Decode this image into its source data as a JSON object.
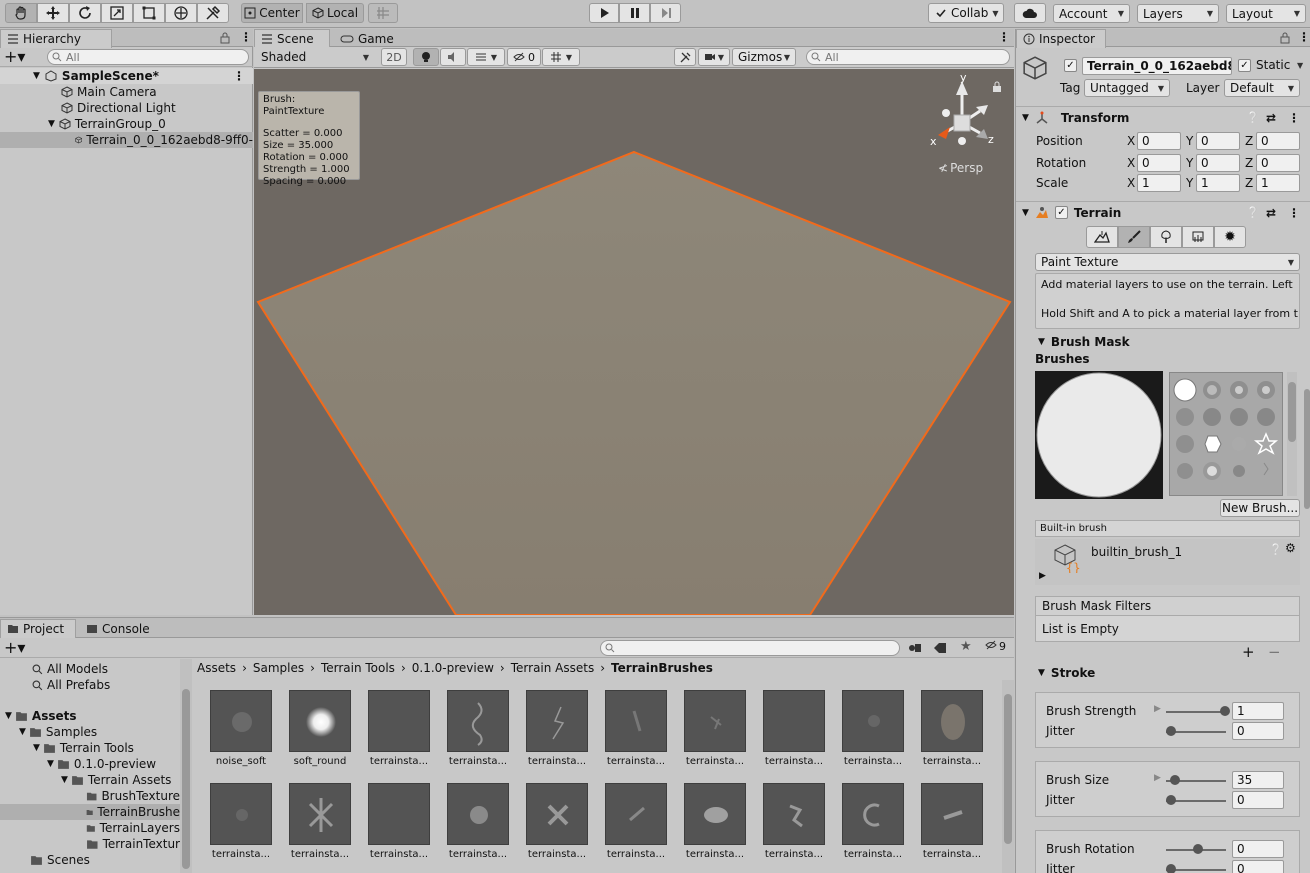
{
  "toolbar": {
    "tools": [
      "hand-icon",
      "move-icon",
      "rotate-icon",
      "scale-icon",
      "rect-icon",
      "transform-icon",
      "custom-tool-icon"
    ],
    "pivot_mode": "Center",
    "pivot_space": "Local",
    "collab_label": "Collab",
    "account_label": "Account",
    "layers_label": "Layers",
    "layout_label": "Layout"
  },
  "hierarchy": {
    "tab_label": "Hierarchy",
    "search_placeholder": "All",
    "scene_name": "SampleScene*",
    "items": [
      {
        "label": "Main Camera"
      },
      {
        "label": "Directional Light"
      },
      {
        "label": "TerrainGroup_0"
      },
      {
        "label": "Terrain_0_0_162aebd8-9ff0-"
      }
    ]
  },
  "scene_view": {
    "tabs": [
      {
        "label": "Scene"
      },
      {
        "label": "Game"
      }
    ],
    "shading_mode": "Shaded",
    "mode_2d": "2D",
    "hidden_count": "0",
    "gizmos_label": "Gizmos",
    "search_placeholder": "All",
    "persp_label": "Persp",
    "gizmo_axes": {
      "y": "y",
      "x": "x",
      "z": "z"
    },
    "brush_overlay": {
      "title": "Brush: PaintTexture",
      "lines": [
        "Scatter = 0.000",
        "Size = 35.000",
        "Rotation = 0.000",
        "Strength = 1.000",
        "Spacing = 0.000"
      ]
    },
    "terrain_color": "#8b8375",
    "outline_color": "#f26a1b"
  },
  "project": {
    "tabs": [
      {
        "label": "Project"
      },
      {
        "label": "Console"
      }
    ],
    "hidden_count": "9",
    "favorites": [
      {
        "label": "All Models"
      },
      {
        "label": "All Prefabs"
      }
    ],
    "tree": [
      {
        "label": "Assets"
      },
      {
        "label": "Samples"
      },
      {
        "label": "Terrain Tools"
      },
      {
        "label": "0.1.0-preview"
      },
      {
        "label": "Terrain Assets"
      },
      {
        "label": "BrushTexture"
      },
      {
        "label": "TerrainBrushe"
      },
      {
        "label": "TerrainLayers"
      },
      {
        "label": "TerrainTextur"
      },
      {
        "label": "Scenes"
      }
    ],
    "breadcrumb": [
      "Assets",
      "Samples",
      "Terrain Tools",
      "0.1.0-preview",
      "Terrain Assets",
      "TerrainBrushes"
    ],
    "assets_row1": [
      "noise_soft",
      "soft_round",
      "terrainsta...",
      "terrainsta...",
      "terrainsta...",
      "terrainsta...",
      "terrainsta...",
      "terrainsta...",
      "terrainsta...",
      "terrainsta..."
    ],
    "assets_row2": [
      "terrainsta...",
      "terrainsta...",
      "terrainsta...",
      "terrainsta...",
      "terrainsta...",
      "terrainsta...",
      "terrainsta...",
      "terrainsta...",
      "terrainsta...",
      "terrainsta..."
    ]
  },
  "inspector": {
    "tab_label": "Inspector",
    "object_name": "Terrain_0_0_162aebd8-9",
    "static_label": "Static",
    "tag_label": "Tag",
    "tag_value": "Untagged",
    "layer_label": "Layer",
    "layer_value": "Default",
    "transform": {
      "title": "Transform",
      "rows": [
        {
          "label": "Position",
          "x": "0",
          "y": "0",
          "z": "0"
        },
        {
          "label": "Rotation",
          "x": "0",
          "y": "0",
          "z": "0"
        },
        {
          "label": "Scale",
          "x": "1",
          "y": "1",
          "z": "1"
        }
      ],
      "axis_x": "X",
      "axis_y": "Y",
      "axis_z": "Z"
    },
    "terrain": {
      "title": "Terrain",
      "tool_icons": [
        "raise-terrain-icon",
        "paint-brush-icon",
        "tree-icon",
        "detail-icon",
        "settings-icon"
      ],
      "tool_select": "Paint Texture",
      "help_line1": "Add material layers to use on the terrain. Left",
      "help_line2": "Hold Shift and A to pick a material layer from t"
    },
    "brush_mask": {
      "title": "Brush Mask",
      "brushes_label": "Brushes",
      "new_brush_label": "New Brush...",
      "built_in_label": "Built-in brush",
      "brush_name": "builtin_brush_1",
      "filters_title": "Brush Mask Filters",
      "filters_empty": "List is Empty"
    },
    "stroke": {
      "title": "Stroke",
      "groups": [
        {
          "label": "Brush Strength",
          "value": "1",
          "jitter_label": "Jitter",
          "jitter": "0",
          "level": 1.0
        },
        {
          "label": "Brush Size",
          "value": "35",
          "jitter_label": "Jitter",
          "jitter": "0",
          "level": 0.07
        },
        {
          "label": "Brush Rotation",
          "value": "0",
          "jitter_label": "Jitter",
          "jitter": "0",
          "level": 0.5
        }
      ]
    }
  }
}
